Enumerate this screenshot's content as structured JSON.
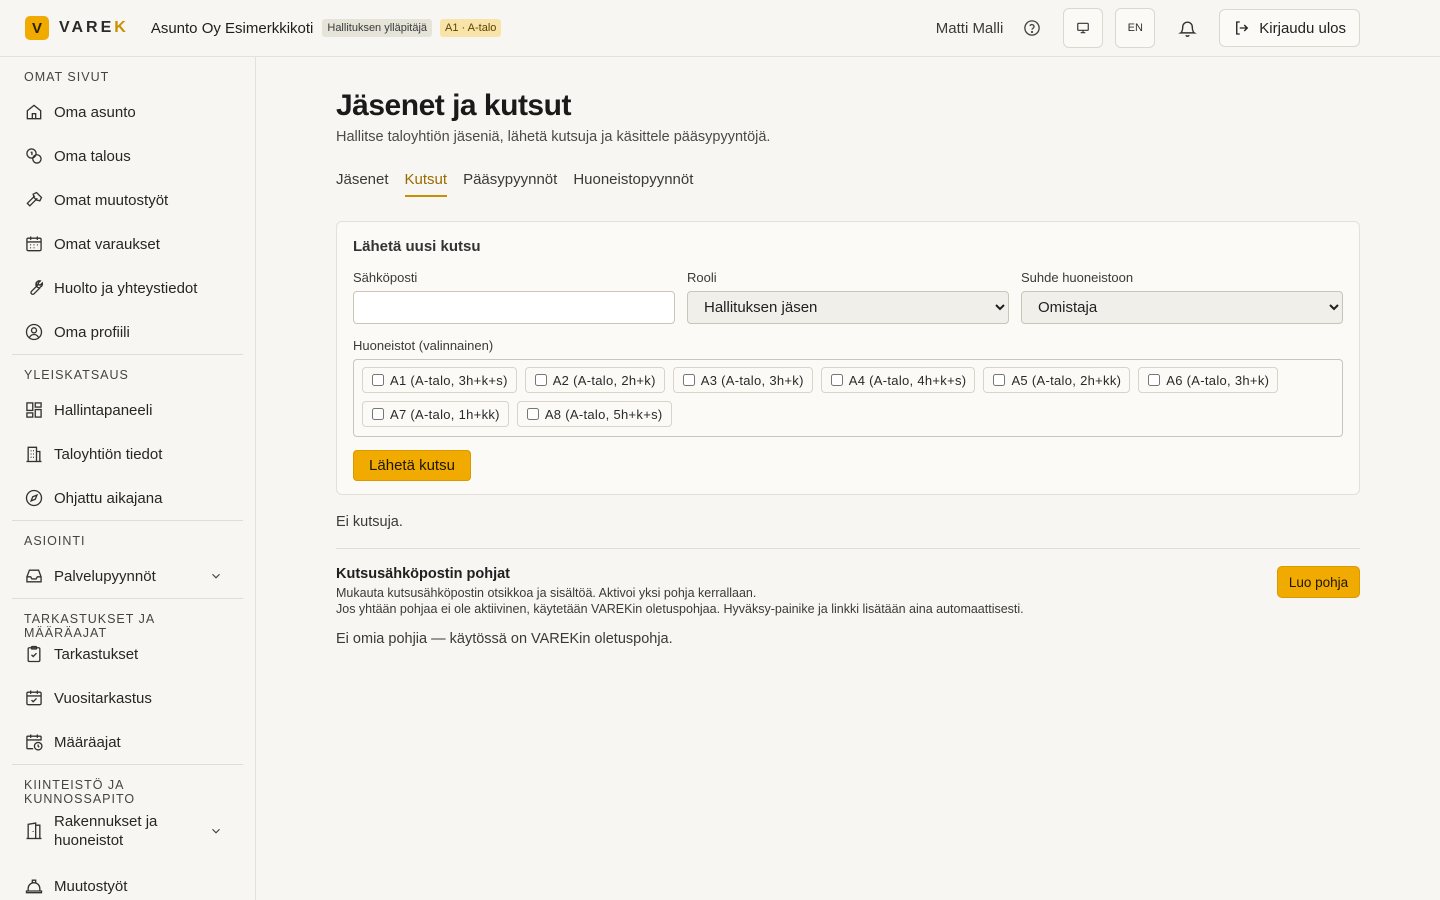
{
  "header": {
    "logo_mark": "V",
    "logo_text_main": "VARE",
    "logo_text_accent": "K",
    "org_name": "Asunto Oy Esimerkkikoti",
    "role_badge": "Hallituksen ylläpitäjä",
    "apartment_badge": "A1 · A-talo",
    "user_name": "Matti Malli",
    "language": "EN",
    "logout_label": "Kirjaudu ulos"
  },
  "sidebar": {
    "sections": [
      {
        "title": "OMAT SIVUT",
        "items": [
          "Oma asunto",
          "Oma talous",
          "Omat muutostyöt",
          "Omat varaukset",
          "Huolto ja yhteystiedot",
          "Oma profiili"
        ]
      },
      {
        "title": "YLEISKATSAUS",
        "items": [
          "Hallintapaneeli",
          "Taloyhtiön tiedot",
          "Ohjattu aikajana"
        ]
      },
      {
        "title": "ASIOINTI",
        "items": [
          "Palvelupyynnöt"
        ]
      },
      {
        "title": "TARKASTUKSET JA MÄÄRÄAJAT",
        "items": [
          "Tarkastukset",
          "Vuositarkastus",
          "Määräajat"
        ]
      },
      {
        "title": "KIINTEISTÖ JA KUNNOSSAPITO",
        "items": [
          "Rakennukset ja huoneistot",
          "Muutostyöt"
        ]
      }
    ]
  },
  "main": {
    "title": "Jäsenet ja kutsut",
    "subtitle": "Hallitse taloyhtiön jäseniä, lähetä kutsuja ja käsittele pääsypyyntöjä.",
    "tabs": [
      "Jäsenet",
      "Kutsut",
      "Pääsypyynnöt",
      "Huoneistopyynnöt"
    ],
    "active_tab": "Kutsut",
    "invite_form": {
      "title": "Lähetä uusi kutsu",
      "email_label": "Sähköposti",
      "email_value": "",
      "role_label": "Rooli",
      "role_value": "Hallituksen jäsen",
      "relation_label": "Suhde huoneistoon",
      "relation_value": "Omistaja",
      "apartments_label": "Huoneistot (valinnainen)",
      "apartments": [
        "A1 (A-talo, 3h+k+s)",
        "A2 (A-talo, 2h+k)",
        "A3 (A-talo, 3h+k)",
        "A4 (A-talo, 4h+k+s)",
        "A5 (A-talo, 2h+kk)",
        "A6 (A-talo, 3h+k)",
        "A7 (A-talo, 1h+kk)",
        "A8 (A-talo, 5h+k+s)"
      ],
      "send_label": "Lähetä kutsu"
    },
    "no_invites": "Ei kutsuja.",
    "templates": {
      "title": "Kutsusähköpostin pohjat",
      "desc_line1": "Mukauta kutsusähköpostin otsikkoa ja sisältöä. Aktivoi yksi pohja kerrallaan.",
      "desc_line2": "Jos yhtään pohjaa ei ole aktiivinen, käytetään VAREKin oletuspohjaa. Hyväksy-painike ja linkki lisätään aina automaattisesti.",
      "create_label": "Luo pohja",
      "empty": "Ei omia pohjia — käytössä on VAREKin oletuspohja."
    }
  },
  "colors": {
    "accent": "#f0aa00",
    "accent_text": "#9a6b00"
  }
}
